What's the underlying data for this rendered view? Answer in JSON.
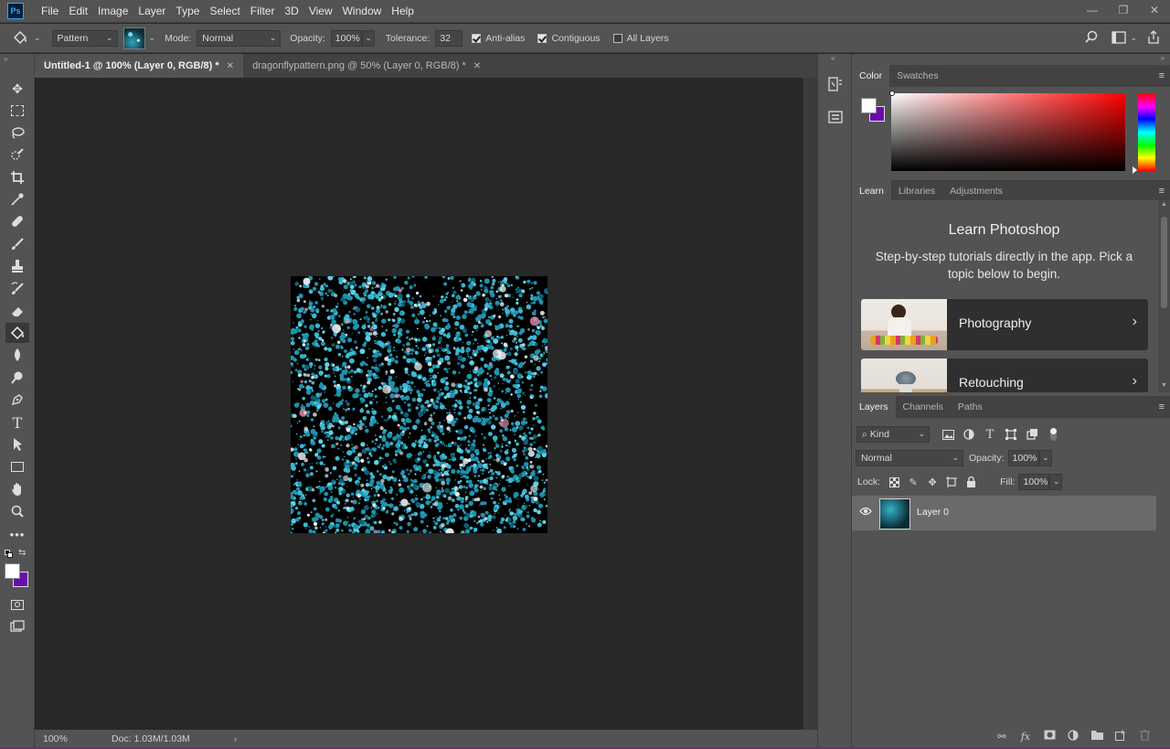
{
  "app": {
    "logo_text": "Ps",
    "menus": [
      "File",
      "Edit",
      "Image",
      "Layer",
      "Type",
      "Select",
      "Filter",
      "3D",
      "View",
      "Window",
      "Help"
    ],
    "window_controls": {
      "minimize": "—",
      "restore": "❐",
      "close": "✕"
    }
  },
  "options": {
    "fill_source": "Pattern",
    "mode_label": "Mode:",
    "mode_value": "Normal",
    "opacity_label": "Opacity:",
    "opacity_value": "100%",
    "tolerance_label": "Tolerance:",
    "tolerance_value": "32",
    "anti_alias_label": "Anti-alias",
    "anti_alias": true,
    "contiguous_label": "Contiguous",
    "contiguous": true,
    "all_layers_label": "All Layers",
    "all_layers": false
  },
  "tabs": [
    {
      "label": "Untitled-1 @ 100% (Layer 0, RGB/8) *",
      "close": "✕",
      "active": true
    },
    {
      "label": "dragonflypattern.png @ 50% (Layer 0, RGB/8) *",
      "close": "✕",
      "active": false
    }
  ],
  "status": {
    "zoom": "100%",
    "doc": "Doc: 1.03M/1.03M",
    "arrow": "›"
  },
  "colors": {
    "foreground": "#ffffff",
    "background": "#6a0dad",
    "accent": "#31a8ff"
  },
  "color_panel": {
    "tabs": [
      "Color",
      "Swatches"
    ]
  },
  "learn_panel": {
    "tabs": [
      "Learn",
      "Libraries",
      "Adjustments"
    ],
    "title": "Learn Photoshop",
    "description": "Step-by-step tutorials directly in the app. Pick a topic below to begin.",
    "cards": [
      {
        "label": "Photography",
        "chevron": "›"
      },
      {
        "label": "Retouching",
        "chevron": "›"
      }
    ]
  },
  "layers_panel": {
    "tabs": [
      "Layers",
      "Channels",
      "Paths"
    ],
    "filter_label": "Kind",
    "blend_mode": "Normal",
    "opacity_label": "Opacity:",
    "opacity_value": "100%",
    "lock_label": "Lock:",
    "fill_label": "Fill:",
    "fill_value": "100%",
    "layers": [
      {
        "name": "Layer 0",
        "visible": true
      }
    ],
    "footer_icons": [
      "link-icon",
      "fx-icon",
      "mask-icon",
      "adjustment-icon",
      "folder-icon",
      "new-layer-icon",
      "trash-icon"
    ]
  },
  "toolbar_icons": [
    "move-icon",
    "marquee-icon",
    "lasso-icon",
    "quick-select-icon",
    "crop-icon",
    "eyedropper-icon",
    "healing-icon",
    "brush-icon",
    "stamp-icon",
    "history-brush-icon",
    "eraser-icon",
    "paint-bucket-icon",
    "blur-icon",
    "dodge-icon",
    "pen-icon",
    "type-icon",
    "path-select-icon",
    "rectangle-icon",
    "hand-icon",
    "zoom-icon",
    "more-tools-icon"
  ]
}
